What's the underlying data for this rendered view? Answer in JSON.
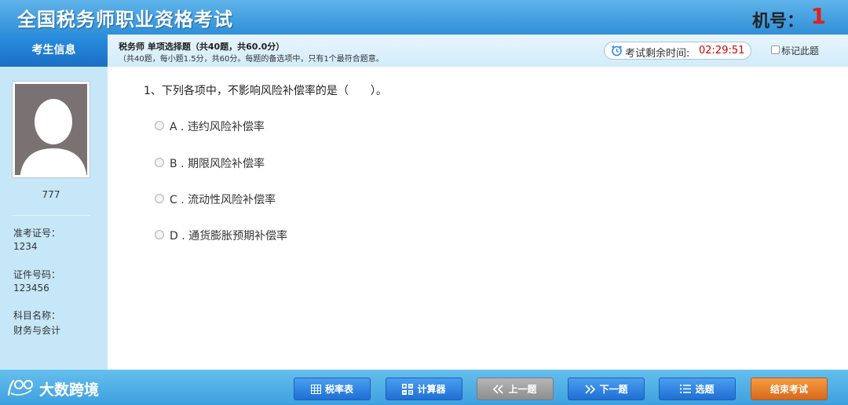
{
  "header": {
    "title": "全国税务师职业资格考试",
    "machine_label": "机号：",
    "machine_number": "1"
  },
  "sidebar": {
    "title": "考生信息",
    "candidate_name": "777",
    "fields": [
      {
        "label": "准考证号：",
        "value": "1234"
      },
      {
        "label": "证件号码：",
        "value": "123456"
      },
      {
        "label": "科目名称：",
        "value": "财务与会计"
      }
    ]
  },
  "info_bar": {
    "section_title": "税务师  单项选择题（共40题，共60.0分）",
    "section_desc": "（共40题，每小题1.5分，共60分。每题的备选项中，只有1个最符合题意。",
    "timer_label": "考试剩余时间:",
    "timer_value": "02:29:51",
    "mark_label": "标记此题"
  },
  "question": {
    "text": "1、下列各项中，不影响风险补偿率的是（　　）。",
    "options": [
      "A . 违约风险补偿率",
      "B . 期限风险补偿率",
      "C . 流动性风险补偿率",
      "D . 通货膨胀预期补偿率"
    ]
  },
  "footer": {
    "brand": "大数跨境",
    "buttons": {
      "tax_table": "税率表",
      "calculator": "计算器",
      "prev": "上一题",
      "next": "下一题",
      "select": "选题",
      "finish": "结束考试"
    }
  },
  "colors": {
    "header_blue": "#2f8fd8",
    "sidebar_bg": "#c6e7f8",
    "timer_red": "#cc0000",
    "machine_number_red": "#e0201b",
    "finish_orange": "#d9691a"
  }
}
